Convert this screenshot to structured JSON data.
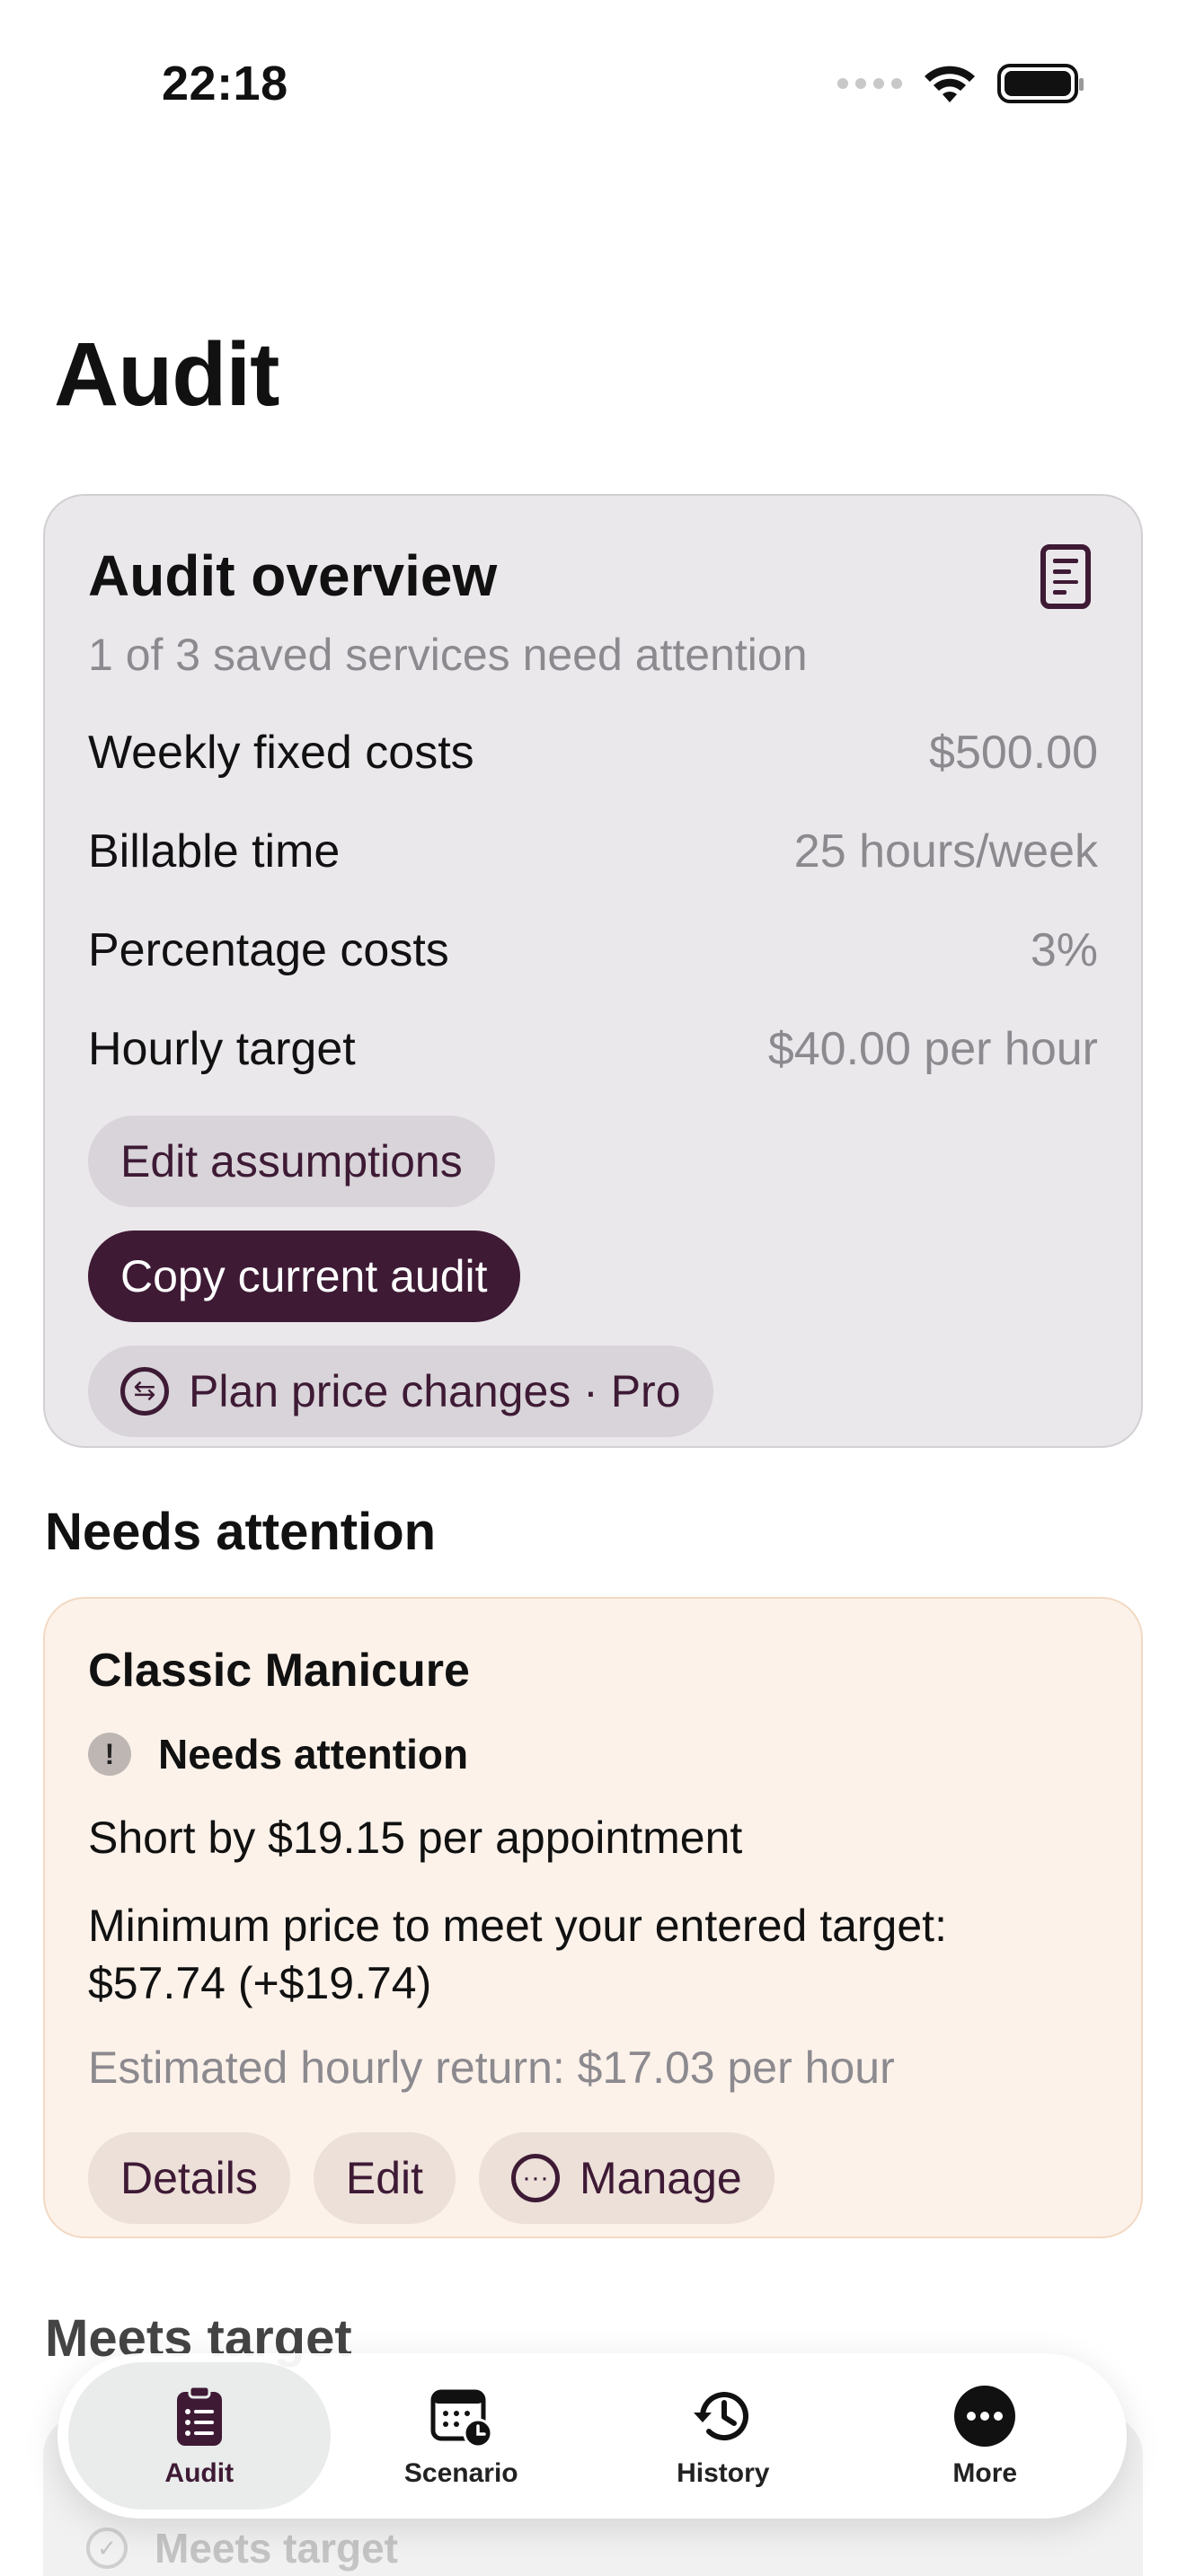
{
  "status_bar": {
    "time": "22:18"
  },
  "page": {
    "title": "Audit"
  },
  "overview": {
    "title": "Audit overview",
    "subtitle": "1 of 3 saved services need attention",
    "rows": [
      {
        "label": "Weekly fixed costs",
        "value": "$500.00"
      },
      {
        "label": "Billable time",
        "value": "25 hours/week"
      },
      {
        "label": "Percentage costs",
        "value": "3%"
      },
      {
        "label": "Hourly target",
        "value": "$40.00 per hour"
      }
    ],
    "buttons": {
      "edit": "Edit assumptions",
      "copy": "Copy current audit",
      "plan": "Plan price changes · Pro"
    }
  },
  "needs_attention": {
    "section_title": "Needs attention",
    "service": "Classic Manicure",
    "status": "Needs attention",
    "short_by": "Short by $19.15 per appointment",
    "minimum_price": "Minimum price to meet your entered target: $57.74 (+$19.74)",
    "hourly_return": "Estimated hourly return: $17.03 per hour",
    "buttons": {
      "details": "Details",
      "edit": "Edit",
      "manage": "Manage"
    }
  },
  "meets_target": {
    "section_title": "Meets target",
    "status": "Meets target"
  },
  "tabbar": {
    "tabs": [
      {
        "label": "Audit",
        "icon": "clipboard-list-icon"
      },
      {
        "label": "Scenario",
        "icon": "calendar-clock-icon"
      },
      {
        "label": "History",
        "icon": "history-icon"
      },
      {
        "label": "More",
        "icon": "ellipsis-circle-icon"
      }
    ],
    "active": "Audit"
  },
  "colors": {
    "brand": "#3e1a35",
    "overview_card": "#ebe8ec",
    "attention_card": "#fcf2ea",
    "muted_text": "#8c8a8f"
  }
}
